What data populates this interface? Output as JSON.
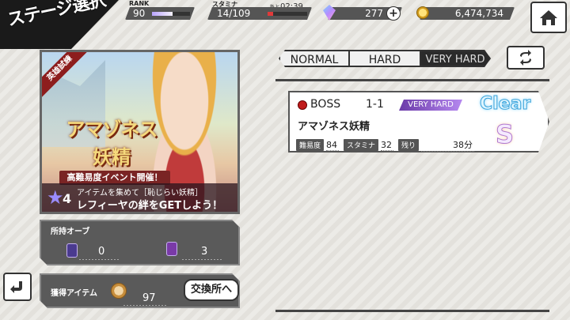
{
  "header": {
    "title": "ステージ選択",
    "rank": {
      "label": "RANK",
      "value": "90",
      "progress": 0.55
    },
    "stamina": {
      "label": "スタミナ",
      "value": "14/109",
      "timer_prefix": "あと",
      "timer": "02:39",
      "progress": 0.13
    },
    "gems": {
      "value": "277",
      "add_label": "+"
    },
    "coins": {
      "value": "6,474,734"
    }
  },
  "event": {
    "ribbon": "英雄試練",
    "title_line1": "アマゾネス",
    "title_line2": "妖精",
    "subtitle": "高難易度イベント開催！",
    "star_num": "4",
    "footer_line1": "アイテムを集めて［恥じらい妖精］",
    "footer_line2": "レフィーヤの絆をGETしよう！"
  },
  "orbs_panel": {
    "label": "所持オーブ",
    "items": [
      {
        "icon": "blue-orb-icon",
        "count": "0"
      },
      {
        "icon": "purple-orb-icon",
        "count": "3"
      }
    ]
  },
  "items_panel": {
    "label": "獲得アイテム",
    "count": "97",
    "exchange_label": "交換所へ"
  },
  "tabs": [
    {
      "label": "NORMAL"
    },
    {
      "label": "HARD"
    },
    {
      "label": "VERY HARD"
    }
  ],
  "stage": {
    "boss_label": "BOSS",
    "number": "1-1",
    "difficulty": "VERY HARD",
    "clear_label": "Clear",
    "name": "アマゾネス妖精",
    "rank": "S",
    "difficulty_chip": "難易度",
    "difficulty_val": "84",
    "stamina_chip": "スタミナ",
    "stamina_val": "32",
    "remaining_chip": "残り",
    "remaining_val": "38分"
  },
  "colors": {
    "accent": "#333333",
    "very_hard": "#6b3aa8",
    "boss": "#c01b1b"
  }
}
